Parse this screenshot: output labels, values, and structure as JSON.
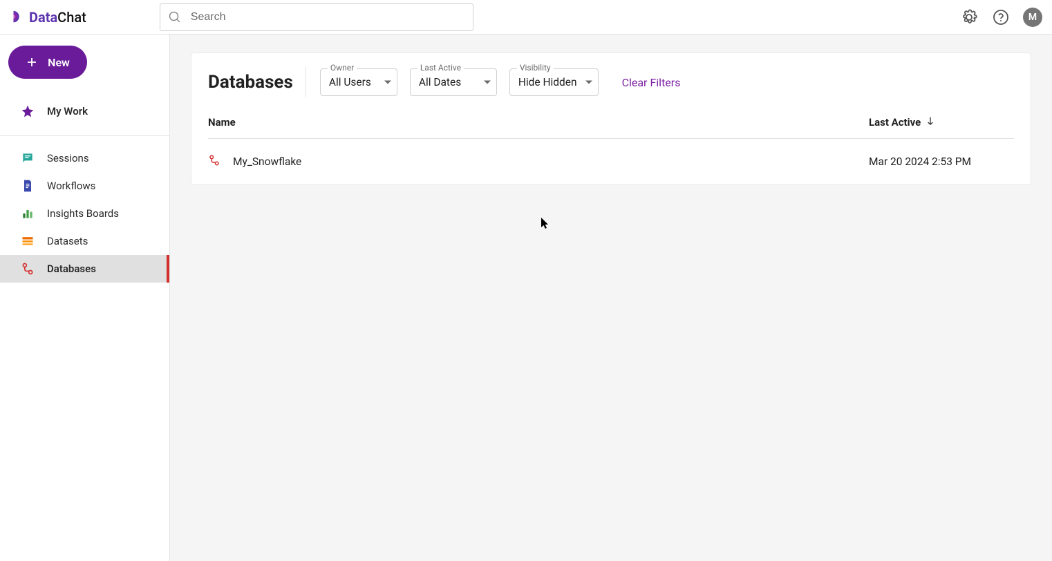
{
  "brand": {
    "part1": "Data",
    "part2": "Chat"
  },
  "search": {
    "placeholder": "Search"
  },
  "avatar": {
    "initial": "M"
  },
  "new_button": {
    "label": "New"
  },
  "sidebar": {
    "mywork": "My Work",
    "items": [
      {
        "label": "Sessions"
      },
      {
        "label": "Workflows"
      },
      {
        "label": "Insights Boards"
      },
      {
        "label": "Datasets"
      },
      {
        "label": "Databases"
      }
    ]
  },
  "page": {
    "title": "Databases",
    "filters": {
      "owner": {
        "label": "Owner",
        "value": "All Users"
      },
      "last_active": {
        "label": "Last Active",
        "value": "All Dates"
      },
      "visibility": {
        "label": "Visibility",
        "value": "Hide Hidden"
      }
    },
    "clear": "Clear Filters",
    "columns": {
      "name": "Name",
      "last_active": "Last Active"
    },
    "rows": [
      {
        "name": "My_Snowflake",
        "last_active": "Mar 20 2024 2:53 PM"
      }
    ]
  }
}
